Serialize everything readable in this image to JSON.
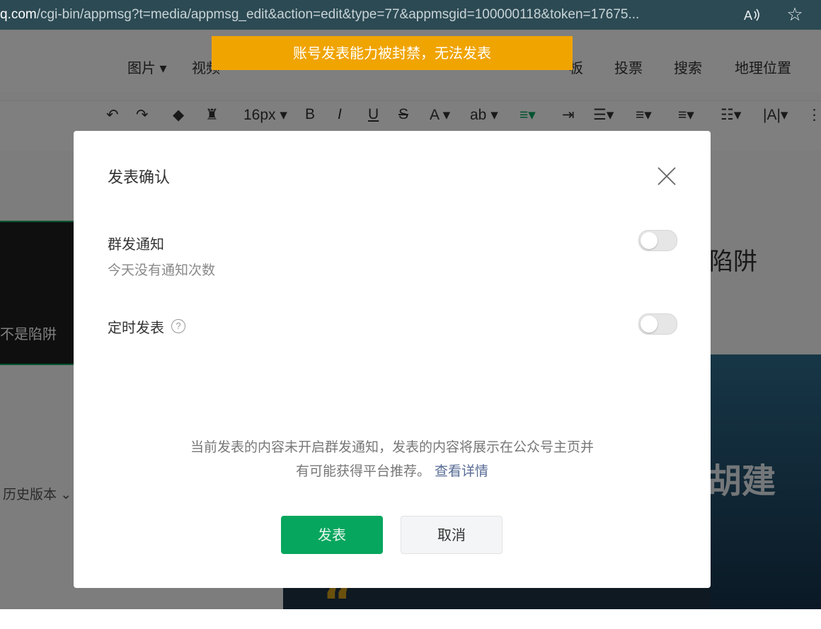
{
  "browser": {
    "url_host": "q.com",
    "url_path": "/cgi-bin/appmsg?t=media/appmsg_edit&action=edit&type=77&appmsgid=100000118&token=17675...",
    "read_aloud_icon": "read-aloud-icon",
    "favorite_icon": "star-icon"
  },
  "editor": {
    "insert_items": [
      "图片 ▾",
      "视频",
      "投票",
      "搜索",
      "地理位置",
      "板"
    ],
    "format_items": {
      "font_size": "16px ▾",
      "bold": "B",
      "italic": "I",
      "underline": "U",
      "strike": "S",
      "font_color": "A ▾",
      "bg_color": "ab ▾"
    },
    "thumbnail_caption": "不是陷阱",
    "history": "历史版本 ⌄",
    "right_title": "陷阱",
    "right_image_text": "胡建",
    "quote_mark": "“"
  },
  "banner": {
    "text": "账号发表能力被封禁，无法发表",
    "color": "#f0a400"
  },
  "dialog": {
    "title": "发表确认",
    "close_icon": "close-icon",
    "options": [
      {
        "label": "群发通知",
        "sub": "今天没有通知次数",
        "enabled": false
      },
      {
        "label": "定时发表",
        "help": "?",
        "enabled": false
      }
    ],
    "notice_line1": "当前发表的内容未开启群发通知，发表的内容将展示在公众号主页并",
    "notice_line2": "有可能获得平台推荐。",
    "notice_link": "查看详情",
    "publish_button": "发表",
    "cancel_button": "取消",
    "primary_color": "#07a65e"
  }
}
